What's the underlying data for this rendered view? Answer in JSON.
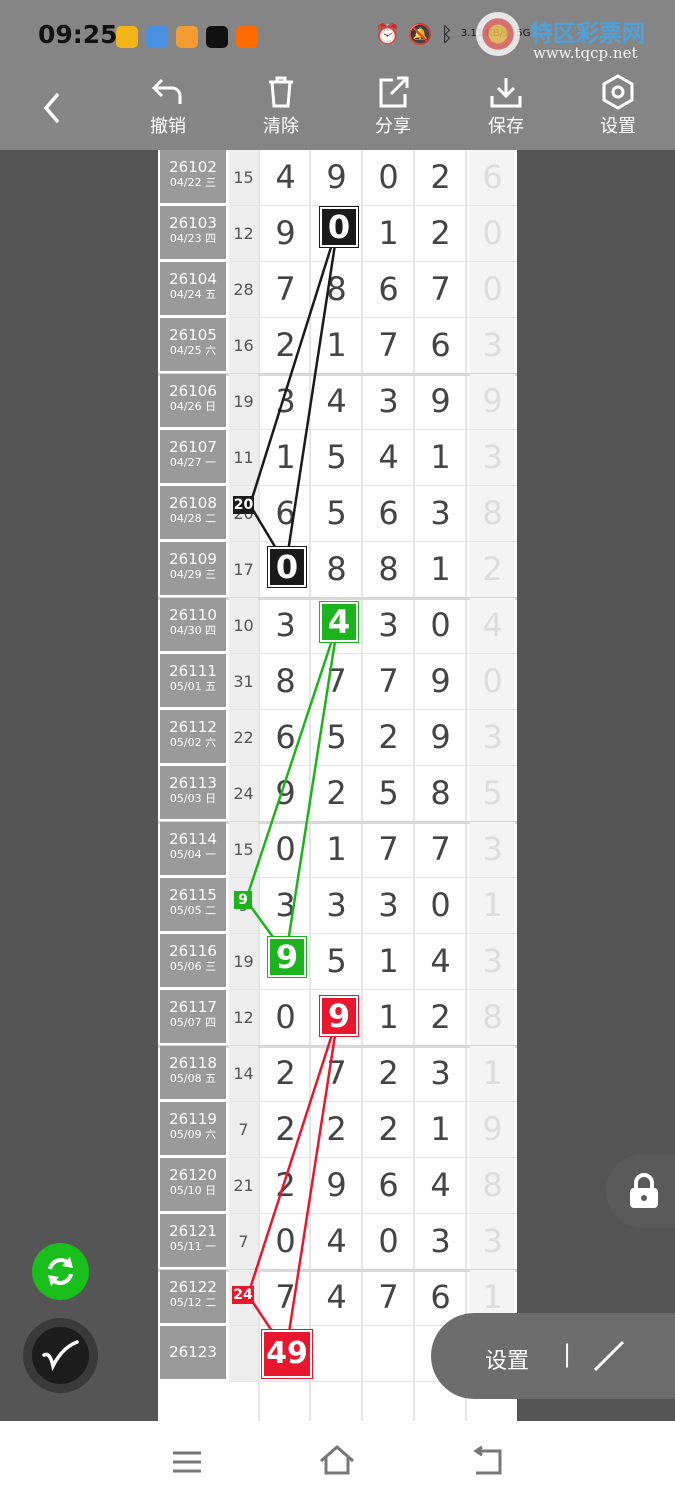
{
  "status": {
    "time": "09:25",
    "net_speed": "3.11 KB/s",
    "net_type": "5G"
  },
  "watermark": {
    "name": "特区彩票网",
    "url": "www.tqcp.net"
  },
  "toolbar": {
    "undo": "撤销",
    "clear": "清除",
    "share": "分享",
    "save": "保存",
    "settings": "设置"
  },
  "rows": [
    {
      "id": "26102",
      "date": "04/22 三",
      "sum": "15",
      "d": [
        "4",
        "9",
        "0",
        "2"
      ],
      "x": "6"
    },
    {
      "id": "26103",
      "date": "04/23 四",
      "sum": "12",
      "d": [
        "9",
        "0",
        "1",
        "2"
      ],
      "x": "0"
    },
    {
      "id": "26104",
      "date": "04/24 五",
      "sum": "28",
      "d": [
        "7",
        "8",
        "6",
        "7"
      ],
      "x": "0"
    },
    {
      "id": "26105",
      "date": "04/25 六",
      "sum": "16",
      "d": [
        "2",
        "1",
        "7",
        "6"
      ],
      "x": "3"
    },
    {
      "id": "26106",
      "date": "04/26 日",
      "sum": "19",
      "d": [
        "3",
        "4",
        "3",
        "9"
      ],
      "x": "9"
    },
    {
      "id": "26107",
      "date": "04/27 一",
      "sum": "11",
      "d": [
        "1",
        "5",
        "4",
        "1"
      ],
      "x": "3"
    },
    {
      "id": "26108",
      "date": "04/28 二",
      "sum": "20",
      "d": [
        "6",
        "5",
        "6",
        "3"
      ],
      "x": "8"
    },
    {
      "id": "26109",
      "date": "04/29 三",
      "sum": "17",
      "d": [
        "0",
        "8",
        "8",
        "1"
      ],
      "x": "2"
    },
    {
      "id": "26110",
      "date": "04/30 四",
      "sum": "10",
      "d": [
        "3",
        "4",
        "3",
        "0"
      ],
      "x": "4"
    },
    {
      "id": "26111",
      "date": "05/01 五",
      "sum": "31",
      "d": [
        "8",
        "7",
        "7",
        "9"
      ],
      "x": "0"
    },
    {
      "id": "26112",
      "date": "05/02 六",
      "sum": "22",
      "d": [
        "6",
        "5",
        "2",
        "9"
      ],
      "x": "3"
    },
    {
      "id": "26113",
      "date": "05/03 日",
      "sum": "24",
      "d": [
        "9",
        "2",
        "5",
        "8"
      ],
      "x": "5"
    },
    {
      "id": "26114",
      "date": "05/04 一",
      "sum": "15",
      "d": [
        "0",
        "1",
        "7",
        "7"
      ],
      "x": "3"
    },
    {
      "id": "26115",
      "date": "05/05 二",
      "sum": "9",
      "d": [
        "3",
        "3",
        "3",
        "0"
      ],
      "x": "1"
    },
    {
      "id": "26116",
      "date": "05/06 三",
      "sum": "19",
      "d": [
        "9",
        "5",
        "1",
        "4"
      ],
      "x": "3"
    },
    {
      "id": "26117",
      "date": "05/07 四",
      "sum": "12",
      "d": [
        "0",
        "9",
        "1",
        "2"
      ],
      "x": "8"
    },
    {
      "id": "26118",
      "date": "05/08 五",
      "sum": "14",
      "d": [
        "2",
        "7",
        "2",
        "3"
      ],
      "x": "1"
    },
    {
      "id": "26119",
      "date": "05/09 六",
      "sum": "7",
      "d": [
        "2",
        "2",
        "2",
        "1"
      ],
      "x": "9"
    },
    {
      "id": "26120",
      "date": "05/10 日",
      "sum": "21",
      "d": [
        "2",
        "9",
        "6",
        "4"
      ],
      "x": "8"
    },
    {
      "id": "26121",
      "date": "05/11 一",
      "sum": "7",
      "d": [
        "0",
        "4",
        "0",
        "3"
      ],
      "x": "3"
    },
    {
      "id": "26122",
      "date": "05/12 二",
      "sum": "24",
      "d": [
        "7",
        "4",
        "7",
        "6"
      ],
      "x": "1"
    },
    {
      "id": "26123",
      "date": "",
      "sum": "",
      "d": [
        "",
        "",
        "",
        ""
      ],
      "x": ""
    }
  ],
  "badges": {
    "black_top": "0",
    "black_side": "20",
    "black_bottom": "0",
    "green_top": "4",
    "green_side": "9",
    "green_bottom": "9",
    "red_top": "9",
    "red_side": "24",
    "red_bottom": "49"
  },
  "colors": {
    "black": "#1a1a1a",
    "green": "#1db31d",
    "red": "#e8172d",
    "toolbar": "#858585"
  },
  "pill": {
    "label": "设置",
    "separator": "|"
  },
  "icons": [
    "back-arrow-icon",
    "undo-icon",
    "trash-icon",
    "share-icon",
    "download-icon",
    "hexagon-settings-icon",
    "lock-icon",
    "refresh-icon",
    "pen-icon",
    "slash-icon",
    "menu-icon",
    "home-icon",
    "return-icon"
  ]
}
